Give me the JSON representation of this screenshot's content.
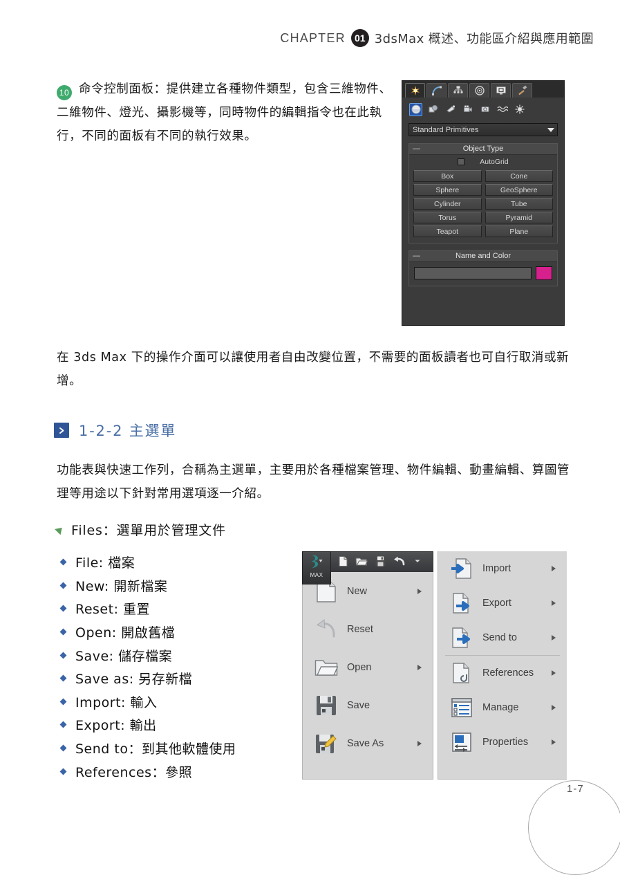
{
  "header": {
    "chapter_word": "CHAPTER",
    "chapter_number": "01",
    "chapter_title": "3dsMax 概述、功能區介紹與應用範圍"
  },
  "paragraphs": {
    "item_number": "10",
    "para_10": "命令控制面板：提供建立各種物件類型，包含三維物件、二維物件、燈光、攝影機等，同時物件的編輯指令也在此執行，不同的面板有不同的執行效果。",
    "para_free": "在 3ds Max 下的操作介面可以讓使用者自由改變位置，不需要的面板讀者也可自行取消或新增。",
    "para_menu": "功能表與快速工作列，合稱為主選單，主要用於各種檔案管理、物件編輯、動畫編輯、算圖管理等用途以下針對常用選項逐一介紹。"
  },
  "section": {
    "number": "1-2-2",
    "title": "主選單",
    "marker_icon": "chevron-right-icon",
    "heading_full": "1-2-2  主選單"
  },
  "files_heading": {
    "bullet_icon": "triangle-bullet-icon",
    "text": "Files：選單用於管理文件"
  },
  "bullet_items": [
    "File: 檔案",
    "New: 開新檔案",
    "Reset: 重置",
    "Open: 開啟舊檔",
    "Save: 儲存檔案",
    "Save as: 另存新檔",
    "Import: 輸入",
    "Export: 輸出",
    "Send to：到其他軟體使用",
    "References：參照"
  ],
  "command_panel": {
    "tabs": [
      {
        "name": "create-tab",
        "icon": "star-icon",
        "active": true
      },
      {
        "name": "modify-tab",
        "icon": "arc-icon",
        "active": false
      },
      {
        "name": "hierarchy-tab",
        "icon": "hierarchy-icon",
        "active": false
      },
      {
        "name": "motion-tab",
        "icon": "motion-wheel-icon",
        "active": false
      },
      {
        "name": "display-tab",
        "icon": "display-monitor-icon",
        "active": false
      },
      {
        "name": "utilities-tab",
        "icon": "hammer-icon",
        "active": false
      }
    ],
    "categories": [
      {
        "name": "geometry",
        "icon": "sphere-icon",
        "selected": true
      },
      {
        "name": "shapes",
        "icon": "shapes-icon",
        "selected": false
      },
      {
        "name": "lights",
        "icon": "light-icon",
        "selected": false
      },
      {
        "name": "cameras",
        "icon": "camera-icon",
        "selected": false
      },
      {
        "name": "helpers",
        "icon": "helper-icon",
        "selected": false
      },
      {
        "name": "space-warps",
        "icon": "wave-icon",
        "selected": false
      },
      {
        "name": "systems",
        "icon": "systems-icon",
        "selected": false
      }
    ],
    "dropdown_value": "Standard Primitives",
    "object_type": {
      "rollout_title": "Object Type",
      "collapse_glyph": "—",
      "autogrid_label": "AutoGrid",
      "autogrid_checked": false,
      "buttons": [
        "Box",
        "Cone",
        "Sphere",
        "GeoSphere",
        "Cylinder",
        "Tube",
        "Torus",
        "Pyramid",
        "Teapot",
        "Plane"
      ]
    },
    "name_and_color": {
      "rollout_title": "Name and Color",
      "collapse_glyph": "—",
      "name_value": "",
      "color_hex": "#d6208c"
    }
  },
  "max_menu": {
    "app_button_label": "MAX",
    "quick_access": [
      {
        "name": "new-file-icon"
      },
      {
        "name": "open-file-icon"
      },
      {
        "name": "save-file-icon"
      },
      {
        "name": "undo-icon"
      },
      {
        "name": "qat-dropdown-icon"
      }
    ],
    "left_items": [
      {
        "label": "New",
        "icon": "new-document-icon",
        "has_submenu": true
      },
      {
        "label": "Reset",
        "icon": "reset-undo-icon",
        "has_submenu": false
      },
      {
        "label": "Open",
        "icon": "open-folder-icon",
        "has_submenu": true
      },
      {
        "label": "Save",
        "icon": "floppy-save-icon",
        "has_submenu": false
      },
      {
        "label": "Save As",
        "icon": "floppy-pencil-icon",
        "has_submenu": true
      }
    ],
    "right_items": [
      {
        "label": "Import",
        "icon": "import-arrow-icon",
        "has_submenu": true
      },
      {
        "label": "Export",
        "icon": "export-arrow-icon",
        "has_submenu": true
      },
      {
        "label": "Send to",
        "icon": "send-to-arrow-icon",
        "has_submenu": true
      },
      {
        "label": "References",
        "icon": "references-link-icon",
        "has_submenu": true
      },
      {
        "label": "Manage",
        "icon": "manage-list-icon",
        "has_submenu": true
      },
      {
        "label": "Properties",
        "icon": "properties-icon",
        "has_submenu": true
      }
    ]
  },
  "footer": {
    "page_number": "1-7"
  },
  "colors": {
    "accent_blue": "#4a6fa5",
    "marker_blue": "#2f5596",
    "bullet_blue": "#3b64a8",
    "green_badge": "#3faa6d",
    "green_triangle": "#5a9a5a",
    "max_pink": "#d6208c"
  }
}
